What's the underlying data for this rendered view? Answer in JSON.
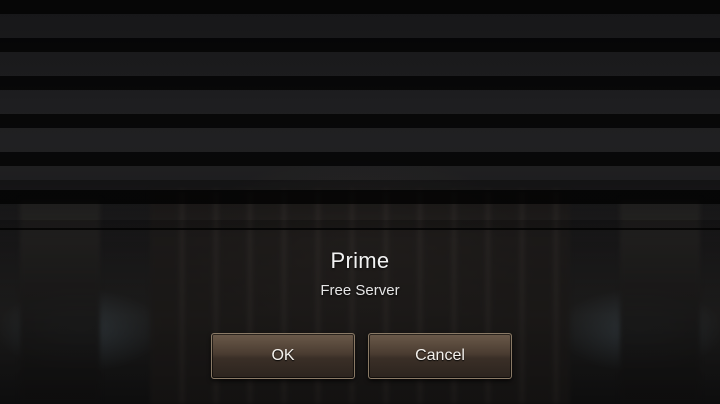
{
  "dialog": {
    "title": "Prime",
    "subtitle": "Free Server",
    "ok_label": "OK",
    "cancel_label": "Cancel"
  },
  "colors": {
    "button_top": "#6b5a4a",
    "button_bottom": "#2c241e",
    "button_border": "#8a7a66",
    "text": "#f2f2f2"
  }
}
